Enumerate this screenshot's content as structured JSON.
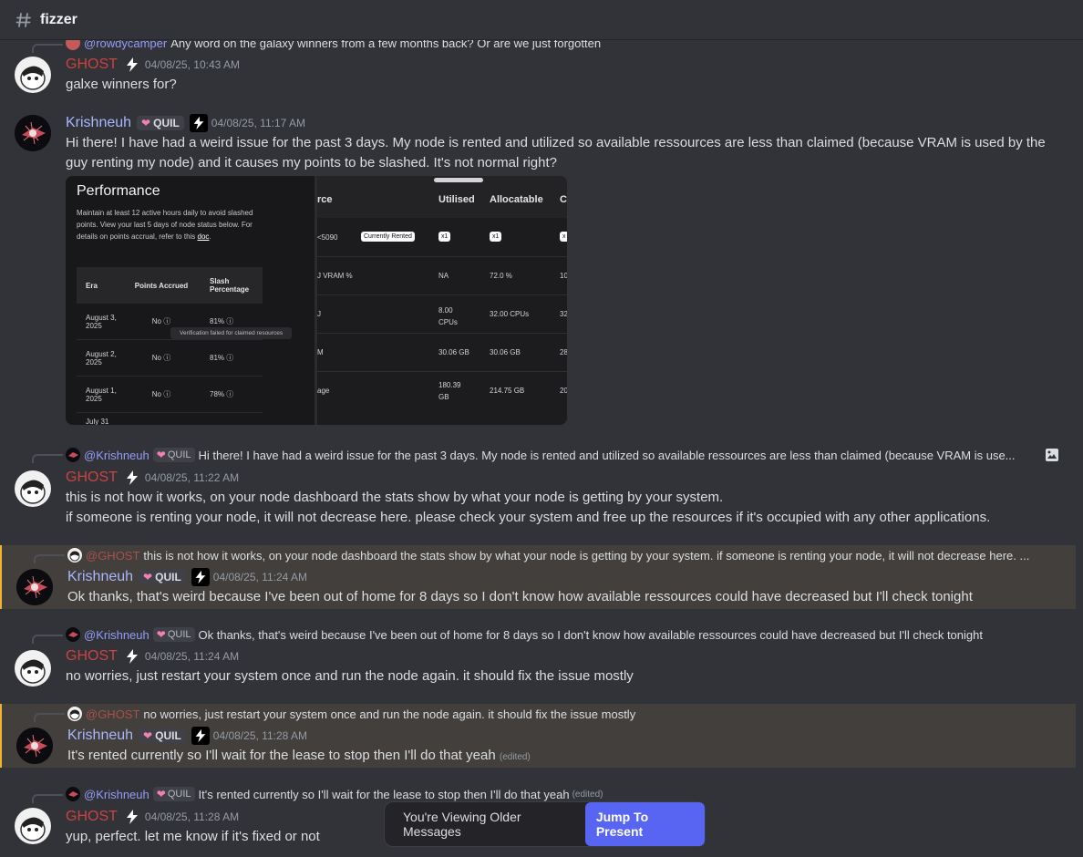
{
  "channel": {
    "name": "fizzer"
  },
  "messages": [
    {
      "reply": {
        "name": "@rowdycamper",
        "text": "Any word on the galaxy winners from a few months back? Or are we just forgotten"
      },
      "author": "GHOST",
      "time": "04/08/25, 10:43 AM",
      "lines": [
        "galxe winners for?"
      ]
    },
    {
      "author": "Krishneuh",
      "tag": "QUIL",
      "time": "04/08/25, 11:17 AM",
      "lines": [
        "Hi there! I have had a weird issue for the past 3 days. My node is rented and utilized so available ressources are less than claimed (because VRAM is used by the guy renting my node) and it causes my points to be slashed. It's not normal right?"
      ],
      "embed": {
        "performance": {
          "title": "Performance",
          "desc_pre": "Maintain at least 12 active hours daily to avoid slashed points. View your last 5 days of node status below. For details on points accrual, refer to this ",
          "desc_link": "doc",
          "desc_post": ".",
          "headers": [
            "Era",
            "Points Accrued",
            "Slash Percentage"
          ],
          "rows": [
            [
              "August 3, 2025",
              "No",
              "81%"
            ],
            [
              "August 2, 2025",
              "No",
              "81%"
            ],
            [
              "August 1, 2025",
              "No",
              "78%"
            ],
            [
              "July 31",
              "",
              ""
            ]
          ],
          "tooltip": "Verification failed for claimed resources"
        },
        "resources": {
          "headers": [
            "rce",
            "Utilised",
            "Allocatable",
            "C"
          ],
          "rows": [
            [
              "<5090",
              "x1",
              "x1",
              "x"
            ],
            [
              "J VRAM %",
              "NA",
              "72.0 %",
              "10"
            ],
            [
              "J",
              "8.00 CPUs",
              "32.00 CPUs",
              "32"
            ],
            [
              "M",
              "30.06 GB",
              "30.06 GB",
              "28"
            ],
            [
              "age",
              "180.39 GB",
              "214.75 GB",
              "20"
            ]
          ],
          "pill": "Currently Rented"
        }
      }
    },
    {
      "reply": {
        "name": "@Krishneuh",
        "tag": "QUIL",
        "text": "Hi there! I have had a weird issue for the past 3 days. My node is rented and utilized so available ressources are less than claimed (because VRAM is use..."
      },
      "author": "GHOST",
      "time": "04/08/25, 11:22 AM",
      "lines": [
        "this is not how it works, on your node dashboard the stats show by what your node is getting by your system.",
        "if someone is renting your node, it will not decrease here. please check your system and free up the resources if it's occupied with any other applications."
      ]
    },
    {
      "reply": {
        "name": "@GHOST",
        "text": "this is not how it works, on your node dashboard the stats show by what your node is getting by your system.  if someone is renting your node, it will not decrease here. ..."
      },
      "author": "Krishneuh",
      "tag": "QUIL",
      "time": "04/08/25, 11:24 AM",
      "lines": [
        "Ok thanks, that's weird because I've been out of home for 8 days so I don't know how available ressources could have decreased but I'll check tonight"
      ]
    },
    {
      "reply": {
        "name": "@Krishneuh",
        "tag": "QUIL",
        "text": "Ok thanks, that's weird because I've been out of home for 8 days so I don't know how available ressources could have decreased but I'll check tonight"
      },
      "author": "GHOST",
      "time": "04/08/25, 11:24 AM",
      "lines": [
        "no worries, just restart your system once and run the node again. it should fix the issue mostly"
      ]
    },
    {
      "reply": {
        "name": "@GHOST",
        "text": "no worries, just restart your system once and run the node again. it should fix the issue mostly"
      },
      "author": "Krishneuh",
      "tag": "QUIL",
      "time": "04/08/25, 11:28 AM",
      "lines": [
        "It's rented currently so I'll wait for the lease to stop then I'll do that yeah"
      ],
      "edited": "(edited)"
    },
    {
      "reply": {
        "name": "@Krishneuh",
        "tag": "QUIL",
        "text": "It's rented currently so I'll wait for the lease to stop then I'll do that yeah",
        "edited": "(edited)"
      },
      "author": "GHOST",
      "time": "04/08/25, 11:28 AM",
      "lines": [
        "yup, perfect. let me know if it's fixed or not"
      ]
    }
  ],
  "jump": {
    "text": "You're Viewing Older Messages",
    "button": "Jump To Present"
  },
  "colors": {
    "ghost": "#c9443f",
    "krishneuh": "#a8b6ff",
    "accent": "#5865f2",
    "highlight": "#f0b232"
  }
}
